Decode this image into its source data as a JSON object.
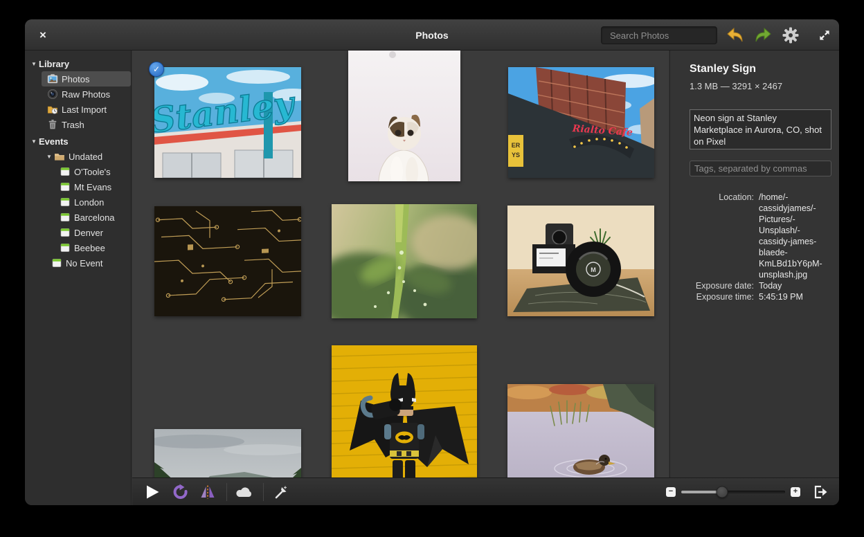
{
  "window": {
    "title": "Photos",
    "close_glyph": "×"
  },
  "search": {
    "placeholder": "Search Photos"
  },
  "colors": {
    "accent_blue": "#3689e6",
    "undo_yellow": "#e9b035",
    "redo_green": "#71a832",
    "event_green": "#79c72e",
    "rotate_purple": "#9268c9"
  },
  "sidebar": {
    "library": {
      "header": "Library",
      "items": [
        {
          "label": "Photos",
          "icon": "photos-icon",
          "selected": true
        },
        {
          "label": "Raw Photos",
          "icon": "raw-photos-icon",
          "selected": false
        },
        {
          "label": "Last Import",
          "icon": "last-import-icon",
          "selected": false
        },
        {
          "label": "Trash",
          "icon": "trash-icon",
          "selected": false
        }
      ]
    },
    "events": {
      "header": "Events",
      "undated": {
        "label": "Undated",
        "icon": "folder-icon"
      },
      "undated_items": [
        {
          "label": "O'Toole's",
          "icon": "event-icon"
        },
        {
          "label": "Mt Evans",
          "icon": "event-icon"
        },
        {
          "label": "London",
          "icon": "event-icon"
        },
        {
          "label": "Barcelona",
          "icon": "event-icon"
        },
        {
          "label": "Denver",
          "icon": "event-icon"
        },
        {
          "label": "Beebee",
          "icon": "event-icon"
        }
      ],
      "no_event": {
        "label": "No Event",
        "icon": "event-icon"
      }
    }
  },
  "grid": {
    "photos": [
      {
        "name": "stanley-sign-photo",
        "selected": true,
        "check_glyph": "✓"
      },
      {
        "name": "cat-photo",
        "selected": false
      },
      {
        "name": "rialto-cafe-photo",
        "selected": false
      },
      {
        "name": "circuit-board-photo",
        "selected": false
      },
      {
        "name": "succulent-photo",
        "selected": false
      },
      {
        "name": "camera-lens-photo",
        "selected": false
      },
      {
        "name": "forest-valley-photo",
        "selected": false
      },
      {
        "name": "lego-batman-photo",
        "selected": false
      },
      {
        "name": "duck-pond-photo",
        "selected": false
      }
    ]
  },
  "details": {
    "title": "Stanley Sign",
    "meta": "1.3 MB — 3291 × 2467",
    "comment": "Neon sign at Stanley Marketplace in Aurora, CO, shot on Pixel",
    "tags_placeholder": "Tags, separated by commas",
    "fields": [
      {
        "label": "Location:",
        "value": "/home/-\ncassidyjames/-\nPictures/-\nUnsplash/-\ncassidy-james-\nblaede-\nKmLBd1bY6pM-\nunsplash.jpg"
      },
      {
        "label": "Exposure date:",
        "value": "Today"
      },
      {
        "label": "Exposure time:",
        "value": "5:45:19 PM"
      }
    ]
  },
  "top_toolbar_icons": [
    "search-icon",
    "undo-icon",
    "redo-icon",
    "gear-icon",
    "fullscreen-icon"
  ],
  "bottom_toolbar": {
    "icons": [
      "slideshow-icon",
      "rotate-icon",
      "flip-icon",
      "cloud-icon",
      "enhance-icon",
      "export-icon"
    ],
    "zoom": {
      "minus_glyph": "−",
      "plus_glyph": "+",
      "value_percent": 39
    }
  }
}
